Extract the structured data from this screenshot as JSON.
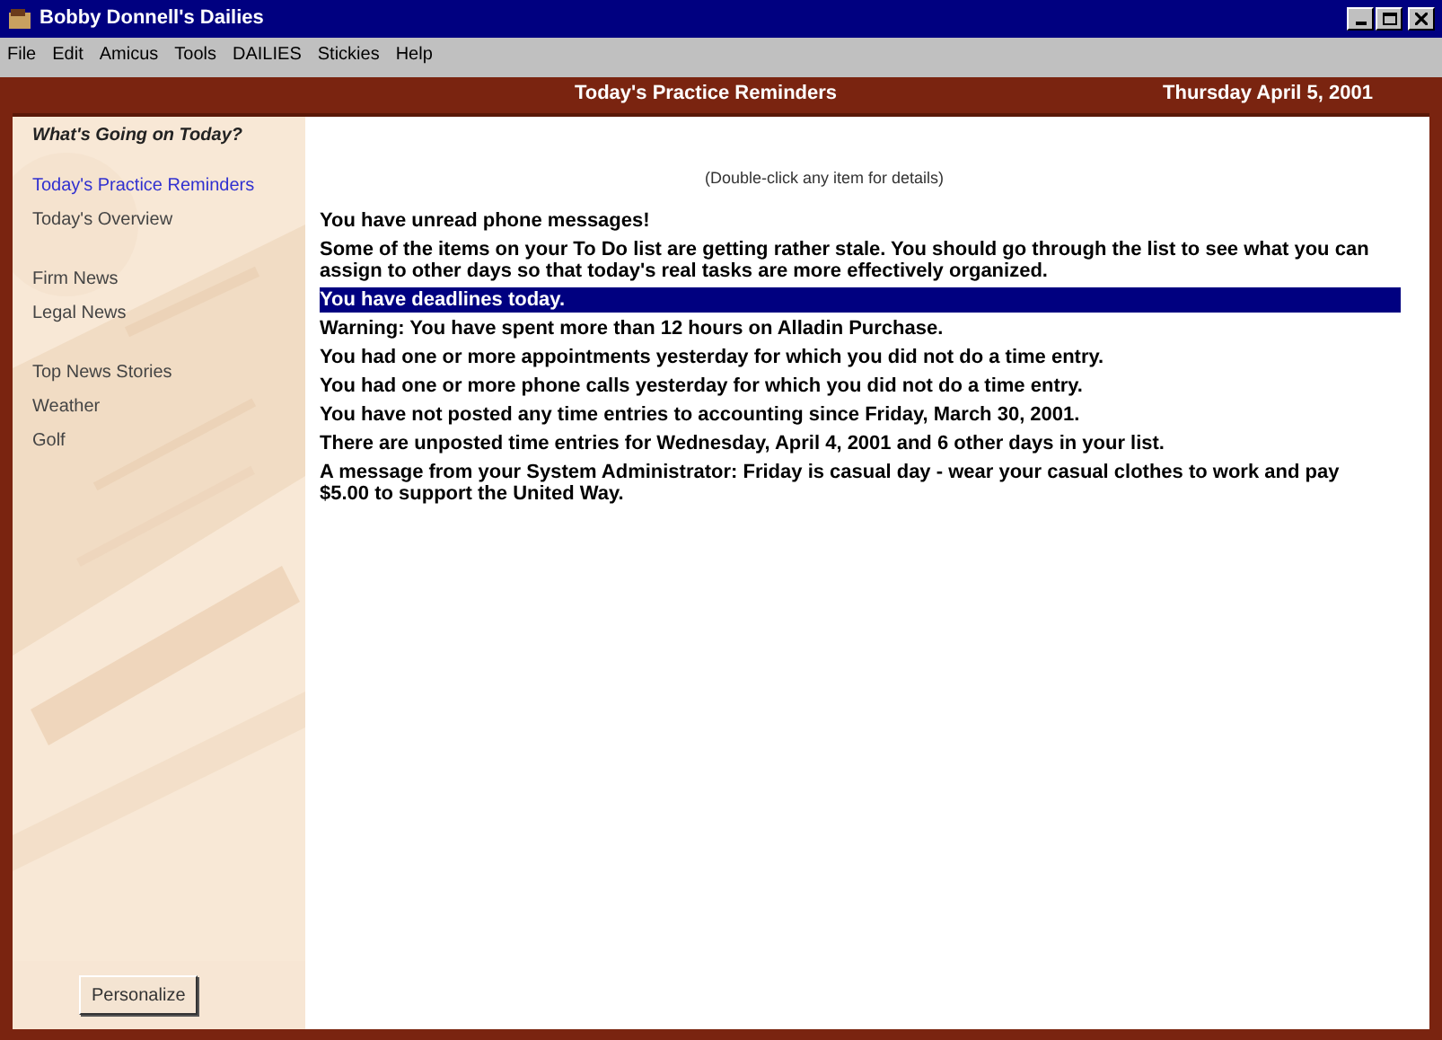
{
  "window": {
    "title": "Bobby Donnell's Dailies"
  },
  "menu": [
    "File",
    "Edit",
    "Amicus",
    "Tools",
    "DAILIES",
    "Stickies",
    "Help"
  ],
  "header": {
    "title": "Today's Practice Reminders",
    "date": "Thursday April 5, 2001"
  },
  "sidebar": {
    "heading": "What's Going on Today?",
    "groups": [
      [
        {
          "label": "Today's Practice Reminders",
          "selected": true
        },
        {
          "label": "Today's Overview",
          "selected": false
        }
      ],
      [
        {
          "label": "Firm News",
          "selected": false
        },
        {
          "label": "Legal News",
          "selected": false
        }
      ],
      [
        {
          "label": "Top News Stories",
          "selected": false
        },
        {
          "label": "Weather",
          "selected": false
        },
        {
          "label": "Golf",
          "selected": false
        }
      ]
    ],
    "button": "Personalize"
  },
  "hint": "(Double-click any item for details)",
  "reminders": [
    {
      "text": "You have unread phone messages!",
      "selected": false
    },
    {
      "text": "Some of the items on your To Do list are getting rather stale.  You should go through the list to see what you can assign to other days so that today's real tasks are more effectively organized.",
      "selected": false
    },
    {
      "text": "You have deadlines today.",
      "selected": true
    },
    {
      "text": "Warning:  You have spent more than 12 hours on Alladin Purchase.",
      "selected": false
    },
    {
      "text": "You had one or more appointments yesterday for which you did not do a time entry.",
      "selected": false
    },
    {
      "text": "You had one or more phone calls yesterday for which you did not do a time entry.",
      "selected": false
    },
    {
      "text": "You have not posted any time entries to accounting since Friday, March 30, 2001.",
      "selected": false
    },
    {
      "text": "There are unposted time entries for Wednesday, April 4, 2001 and 6 other days in your list.",
      "selected": false
    },
    {
      "text": "A message from your System Administrator: Friday is casual day - wear your casual clothes to work and pay $5.00 to support the United Way.",
      "selected": false
    }
  ]
}
